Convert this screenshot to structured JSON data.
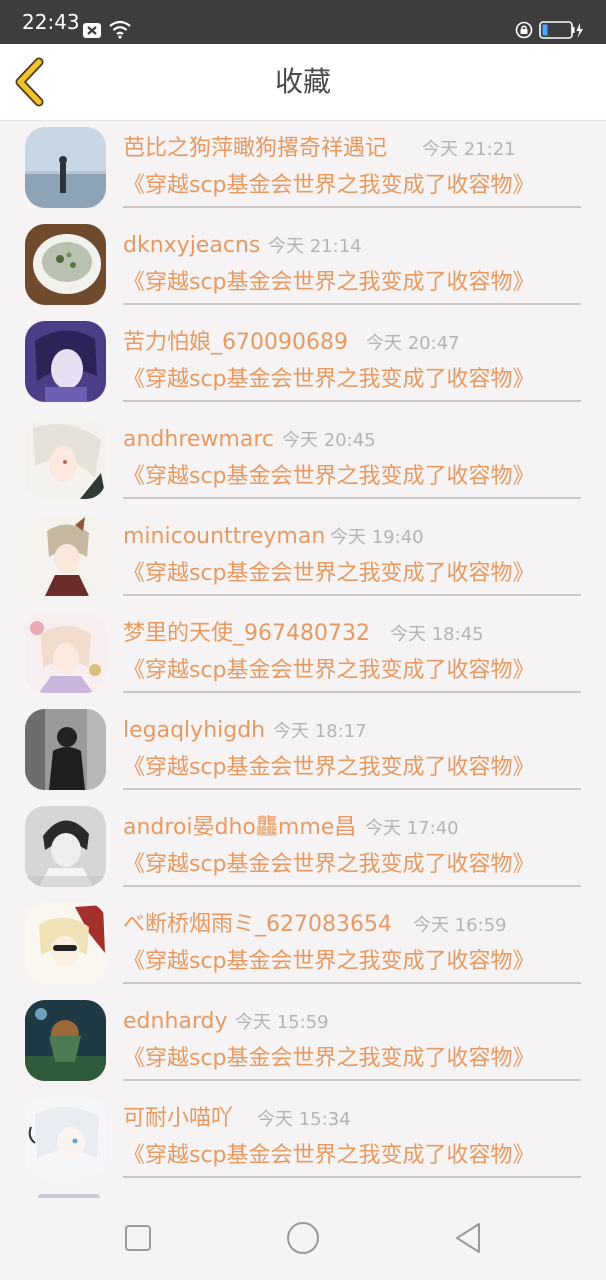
{
  "status_bar": {
    "time": "22:43"
  },
  "header": {
    "title": "收藏"
  },
  "colors": {
    "accent": "#e69a62",
    "back_arrow": "#f0c32e",
    "time_text": "#b4b4b4",
    "status_bar_bg": "#3d3d3d",
    "divider": "#c9c6c6"
  },
  "items": [
    {
      "name": "芭比之狗萍瞰狗撂奇祥遇记",
      "time": "今天 21:21",
      "title": "《穿越scp基金会世界之我变成了收容物》"
    },
    {
      "name": "dknxyjeacns",
      "time": "今天 21:14",
      "title": "《穿越scp基金会世界之我变成了收容物》"
    },
    {
      "name": "苦力怕娘_670090689",
      "time": "今天 20:47",
      "title": "《穿越scp基金会世界之我变成了收容物》"
    },
    {
      "name": "andhrewmarc",
      "time": "今天 20:45",
      "title": "《穿越scp基金会世界之我变成了收容物》"
    },
    {
      "name": "minicounttreyman",
      "time": "今天 19:40",
      "title": "《穿越scp基金会世界之我变成了收容物》"
    },
    {
      "name": "梦里的天使_967480732",
      "time": "今天 18:45",
      "title": "《穿越scp基金会世界之我变成了收容物》"
    },
    {
      "name": "legaqlyhigdh",
      "time": "今天 18:17",
      "title": "《穿越scp基金会世界之我变成了收容物》"
    },
    {
      "name": "androi晏dho龘mme昌",
      "time": "今天 17:40",
      "title": "《穿越scp基金会世界之我变成了收容物》"
    },
    {
      "name": "べ断桥烟雨ミ_627083654",
      "time": "今天 16:59",
      "title": "《穿越scp基金会世界之我变成了收容物》"
    },
    {
      "name": "ednhardy",
      "time": "今天 15:59",
      "title": "《穿越scp基金会世界之我变成了收容物》"
    },
    {
      "name": "可耐小喵吖",
      "time": "今天 15:34",
      "title": "《穿越scp基金会世界之我变成了收容物》"
    }
  ],
  "nav_bar": {
    "buttons": [
      {
        "icon": "square-recents-icon"
      },
      {
        "icon": "circle-home-icon"
      },
      {
        "icon": "triangle-back-icon"
      }
    ]
  }
}
